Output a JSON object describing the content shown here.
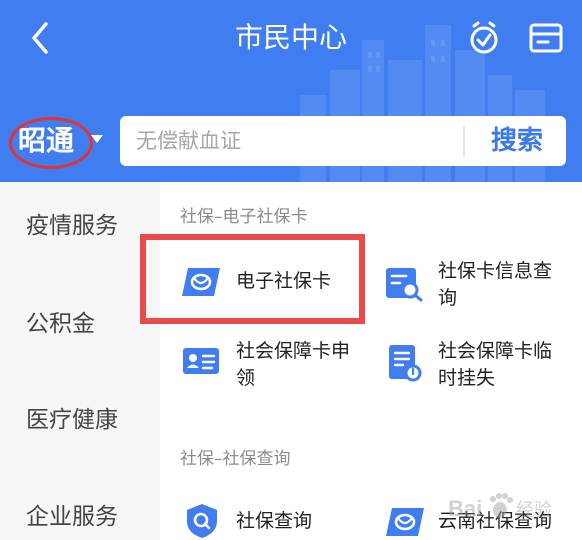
{
  "header": {
    "title": "市民中心",
    "city": "昭通",
    "search_placeholder": "无偿献血证",
    "search_button": "搜索",
    "bg_color": "#3f7df0"
  },
  "sidebar": {
    "items": [
      {
        "label": "疫情服务"
      },
      {
        "label": "公积金"
      },
      {
        "label": "医疗健康"
      },
      {
        "label": "企业服务"
      }
    ]
  },
  "sections": [
    {
      "title": "社保–电子社保卡",
      "items": [
        {
          "label": "电子社保卡",
          "icon": "social-security-card-icon"
        },
        {
          "line1": "社保卡信息查",
          "line2": "询",
          "icon": "card-info-query-icon"
        },
        {
          "line1": "社会保障卡申",
          "line2": "领",
          "icon": "id-card-apply-icon"
        },
        {
          "line1": "社会保障卡临",
          "line2": "时挂失",
          "icon": "report-loss-icon"
        }
      ]
    },
    {
      "title": "社保–社保查询",
      "items": [
        {
          "label": "社保查询",
          "icon": "shield-search-icon"
        },
        {
          "label": "云南社保查询",
          "icon": "social-security-card-icon"
        }
      ]
    }
  ],
  "watermark": {
    "text": "Bai",
    "text2": "经验"
  }
}
